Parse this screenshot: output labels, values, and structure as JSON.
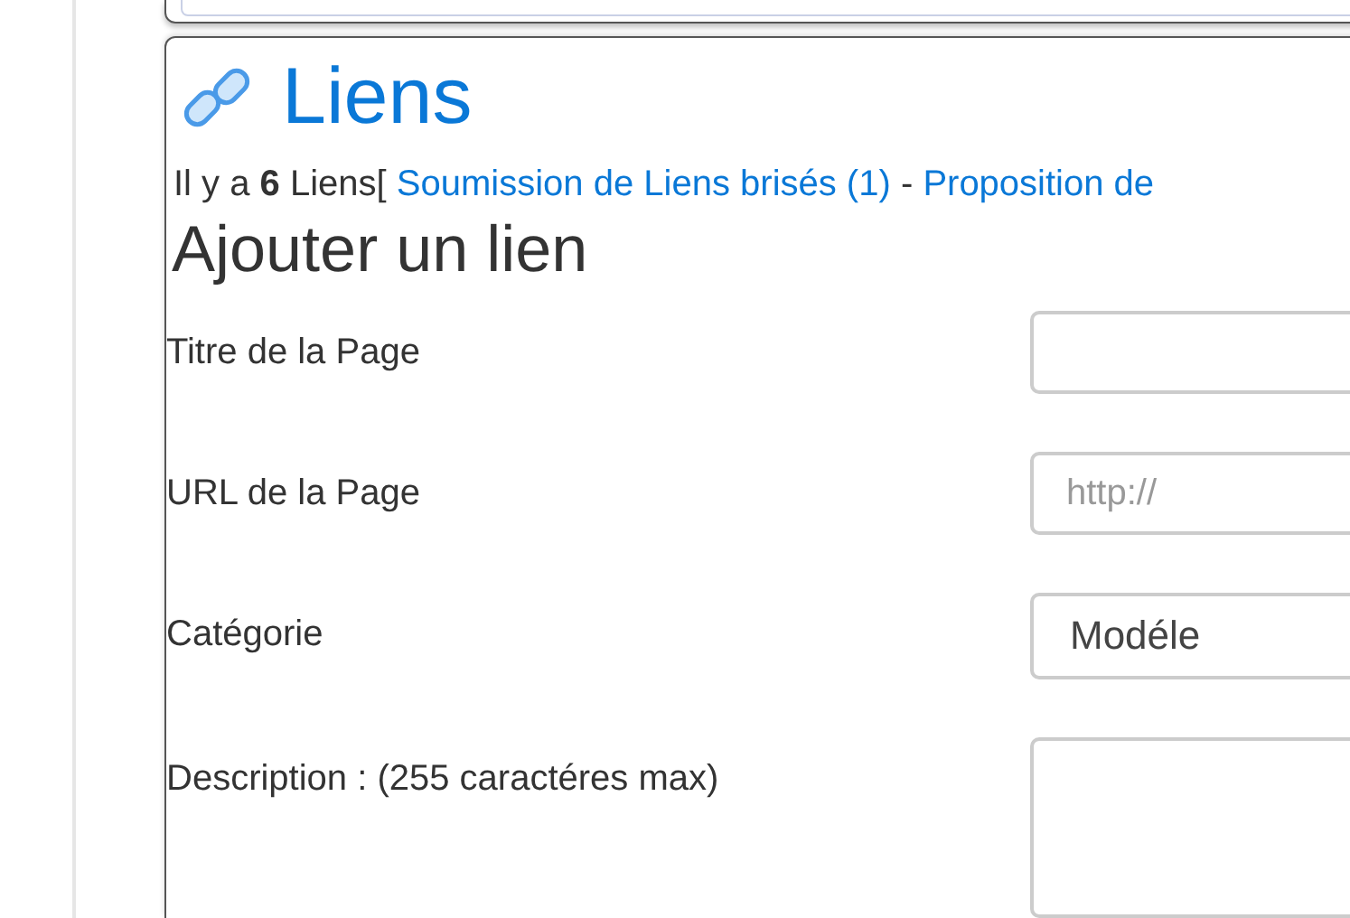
{
  "header": {
    "title": "Liens"
  },
  "summary": {
    "prefix": "Il y a **6** Liens[",
    "separator": "-",
    "links": [
      {
        "text": "Soumission de Liens brisés (1)"
      },
      {
        "text": "Proposition de"
      }
    ]
  },
  "form": {
    "title": "Ajouter un lien",
    "fields": [
      {
        "kind": "text",
        "label": "Titre de la Page"
      },
      {
        "kind": "text",
        "label": "URL de la Page",
        "placeholder": "http://"
      },
      {
        "kind": "select",
        "label": "Catégorie",
        "value": "Modéle"
      },
      {
        "kind": "textarea",
        "label": "Description : (255 caractéres max)"
      }
    ]
  }
}
